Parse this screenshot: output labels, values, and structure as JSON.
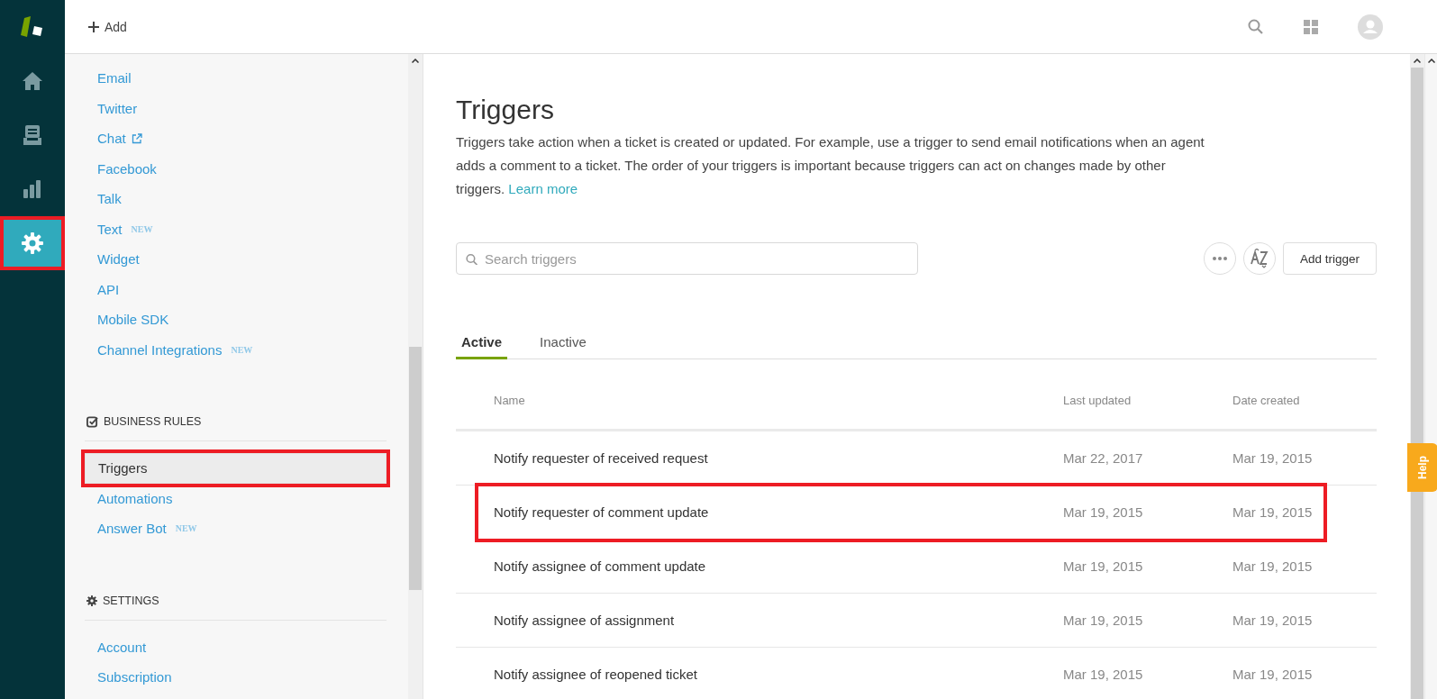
{
  "nav": [
    {
      "kind": "home",
      "selected": false,
      "highlight": false
    },
    {
      "kind": "tickets",
      "selected": false,
      "highlight": false
    },
    {
      "kind": "reports",
      "selected": false,
      "highlight": false
    },
    {
      "kind": "admin",
      "selected": true,
      "highlight": true
    }
  ],
  "header": {
    "add_label": "Add"
  },
  "sidebar": {
    "top_items": [
      {
        "label": "Email",
        "selected": false,
        "highlight": false
      },
      {
        "label": "Twitter",
        "selected": false,
        "highlight": false
      },
      {
        "label": "Chat",
        "external": true,
        "selected": false,
        "highlight": false
      },
      {
        "label": "Facebook",
        "selected": false,
        "highlight": false
      },
      {
        "label": "Talk",
        "selected": false,
        "highlight": false
      },
      {
        "label": "Text",
        "badge": "NEW",
        "selected": false,
        "highlight": false
      },
      {
        "label": "Widget",
        "selected": false,
        "highlight": false
      },
      {
        "label": "API",
        "selected": false,
        "highlight": false
      },
      {
        "label": "Mobile SDK",
        "selected": false,
        "highlight": false
      },
      {
        "label": "Channel Integrations",
        "badge": "NEW",
        "selected": false,
        "highlight": false
      }
    ],
    "sections": [
      {
        "kind": "check",
        "title": "BUSINESS RULES",
        "items": [
          {
            "label": "Triggers",
            "selected": true,
            "highlight": true
          },
          {
            "label": "Automations",
            "selected": false,
            "highlight": false
          },
          {
            "label": "Answer Bot",
            "badge": "NEW",
            "selected": false,
            "highlight": false
          }
        ]
      },
      {
        "kind": "gear",
        "title": "SETTINGS",
        "items": [
          {
            "label": "Account",
            "selected": false,
            "highlight": false
          },
          {
            "label": "Subscription",
            "selected": false,
            "highlight": false
          }
        ]
      }
    ]
  },
  "page": {
    "title": "Triggers",
    "description": "Triggers take action when a ticket is created or updated. For example, use a trigger to send email notifications when an agent adds a comment to a ticket. The order of your triggers is important because triggers can act on changes made by other triggers.",
    "learn_more": "Learn more",
    "search_placeholder": "Search triggers",
    "add_button": "Add trigger"
  },
  "tabs": [
    {
      "label": "Active",
      "selected": true
    },
    {
      "label": "Inactive",
      "selected": false
    }
  ],
  "table": {
    "columns": [
      "Name",
      "Last updated",
      "Date created"
    ],
    "rows": [
      {
        "cells": [
          "Notify requester of received request",
          "Mar 22, 2017",
          "Mar 19, 2015"
        ],
        "highlight": false
      },
      {
        "cells": [
          "Notify requester of comment update",
          "Mar 19, 2015",
          "Mar 19, 2015"
        ],
        "highlight": true
      },
      {
        "cells": [
          "Notify assignee of comment update",
          "Mar 19, 2015",
          "Mar 19, 2015"
        ],
        "highlight": false
      },
      {
        "cells": [
          "Notify assignee of assignment",
          "Mar 19, 2015",
          "Mar 19, 2015"
        ],
        "highlight": false
      },
      {
        "cells": [
          "Notify assignee of reopened ticket",
          "Mar 19, 2015",
          "Mar 19, 2015"
        ],
        "highlight": false
      }
    ]
  },
  "help_tab": "Help"
}
